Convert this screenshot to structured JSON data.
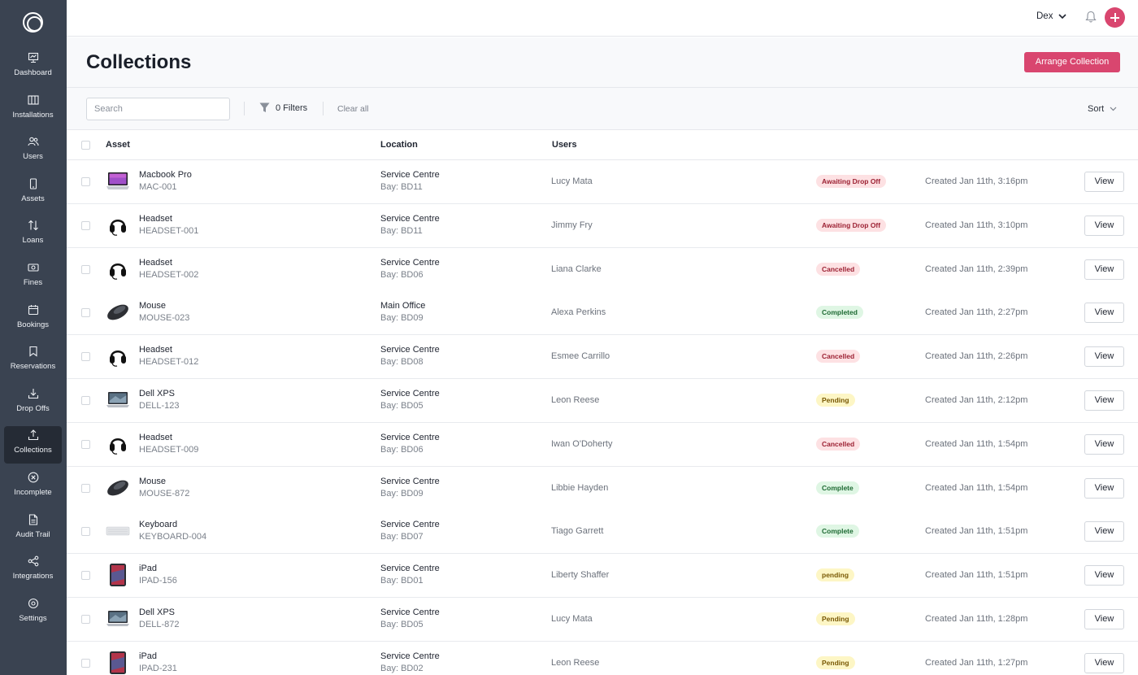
{
  "sidebar": {
    "items": [
      {
        "label": "Dashboard",
        "icon": "dashboard-icon"
      },
      {
        "label": "Installations",
        "icon": "installations-icon"
      },
      {
        "label": "Users",
        "icon": "users-icon"
      },
      {
        "label": "Assets",
        "icon": "assets-icon"
      },
      {
        "label": "Loans",
        "icon": "loans-icon"
      },
      {
        "label": "Fines",
        "icon": "fines-icon"
      },
      {
        "label": "Bookings",
        "icon": "bookings-icon"
      },
      {
        "label": "Reservations",
        "icon": "reservations-icon"
      },
      {
        "label": "Drop Offs",
        "icon": "drop-offs-icon"
      },
      {
        "label": "Collections",
        "icon": "collections-icon",
        "active": true
      },
      {
        "label": "Incomplete",
        "icon": "incomplete-icon"
      },
      {
        "label": "Audit Trail",
        "icon": "audit-trail-icon"
      },
      {
        "label": "Integrations",
        "icon": "integrations-icon"
      },
      {
        "label": "Settings",
        "icon": "settings-icon"
      }
    ]
  },
  "topbar": {
    "user_name": "Dex"
  },
  "header": {
    "title": "Collections",
    "arrange_label": "Arrange Collection"
  },
  "toolbar": {
    "search_placeholder": "Search",
    "filters_label": "0 Filters",
    "clear_label": "Clear all",
    "sort_label": "Sort"
  },
  "table": {
    "columns": {
      "asset": "Asset",
      "location": "Location",
      "users": "Users"
    },
    "view_label": "View",
    "rows": [
      {
        "asset": "Macbook Pro",
        "code": "MAC-001",
        "thumb": "laptop-purple",
        "location": "Service Centre",
        "bay": "Bay: BD11",
        "user": "Lucy Mata",
        "status": "Awaiting Drop Off",
        "tone": "pink",
        "created": "Created Jan 11th, 3:16pm"
      },
      {
        "asset": "Headset",
        "code": "HEADSET-001",
        "thumb": "headset",
        "location": "Service Centre",
        "bay": "Bay: BD11",
        "user": "Jimmy Fry",
        "status": "Awaiting Drop Off",
        "tone": "pink",
        "created": "Created Jan 11th, 3:10pm"
      },
      {
        "asset": "Headset",
        "code": "HEADSET-002",
        "thumb": "headset",
        "location": "Service Centre",
        "bay": "Bay: BD06",
        "user": "Liana Clarke",
        "status": "Cancelled",
        "tone": "pink",
        "created": "Created Jan 11th, 2:39pm"
      },
      {
        "asset": "Mouse",
        "code": "MOUSE-023",
        "thumb": "mouse",
        "location": "Main Office",
        "bay": "Bay: BD09",
        "user": "Alexa Perkins",
        "status": "Completed",
        "tone": "green",
        "created": "Created Jan 11th, 2:27pm"
      },
      {
        "asset": "Headset",
        "code": "HEADSET-012",
        "thumb": "headset",
        "location": "Service Centre",
        "bay": "Bay: BD08",
        "user": "Esmee Carrillo",
        "status": "Cancelled",
        "tone": "pink",
        "created": "Created Jan 11th, 2:26pm"
      },
      {
        "asset": "Dell XPS",
        "code": "DELL-123",
        "thumb": "laptop-dark",
        "location": "Service Centre",
        "bay": "Bay: BD05",
        "user": "Leon Reese",
        "status": "Pending",
        "tone": "yellow",
        "created": "Created Jan 11th, 2:12pm"
      },
      {
        "asset": "Headset",
        "code": "HEADSET-009",
        "thumb": "headset",
        "location": "Service Centre",
        "bay": "Bay: BD06",
        "user": "Iwan O'Doherty",
        "status": "Cancelled",
        "tone": "pink",
        "created": "Created Jan 11th, 1:54pm"
      },
      {
        "asset": "Mouse",
        "code": "MOUSE-872",
        "thumb": "mouse",
        "location": "Service Centre",
        "bay": "Bay: BD09",
        "user": "Libbie Hayden",
        "status": "Complete",
        "tone": "green",
        "created": "Created Jan 11th, 1:54pm"
      },
      {
        "asset": "Keyboard",
        "code": "KEYBOARD-004",
        "thumb": "keyboard",
        "location": "Service Centre",
        "bay": "Bay: BD07",
        "user": "Tiago Garrett",
        "status": "Complete",
        "tone": "green",
        "created": "Created Jan 11th, 1:51pm"
      },
      {
        "asset": "iPad",
        "code": "IPAD-156",
        "thumb": "tablet",
        "location": "Service Centre",
        "bay": "Bay: BD01",
        "user": "Liberty Shaffer",
        "status": "pending",
        "tone": "yellow",
        "created": "Created Jan 11th, 1:51pm"
      },
      {
        "asset": "Dell XPS",
        "code": "DELL-872",
        "thumb": "laptop-dark",
        "location": "Service Centre",
        "bay": "Bay: BD05",
        "user": "Lucy Mata",
        "status": "Pending",
        "tone": "yellow",
        "created": "Created Jan 11th, 1:28pm"
      },
      {
        "asset": "iPad",
        "code": "IPAD-231",
        "thumb": "tablet",
        "location": "Service Centre",
        "bay": "Bay: BD02",
        "user": "Leon Reese",
        "status": "Pending",
        "tone": "yellow",
        "created": "Created Jan 11th, 1:27pm"
      }
    ]
  },
  "colors": {
    "sidebar": "#3a4351",
    "sidebar_active": "#252b35",
    "accent": "#d9466f",
    "badge_pink": "#fde1e3",
    "badge_green": "#dff6e4",
    "badge_yellow": "#fdf6c5"
  }
}
